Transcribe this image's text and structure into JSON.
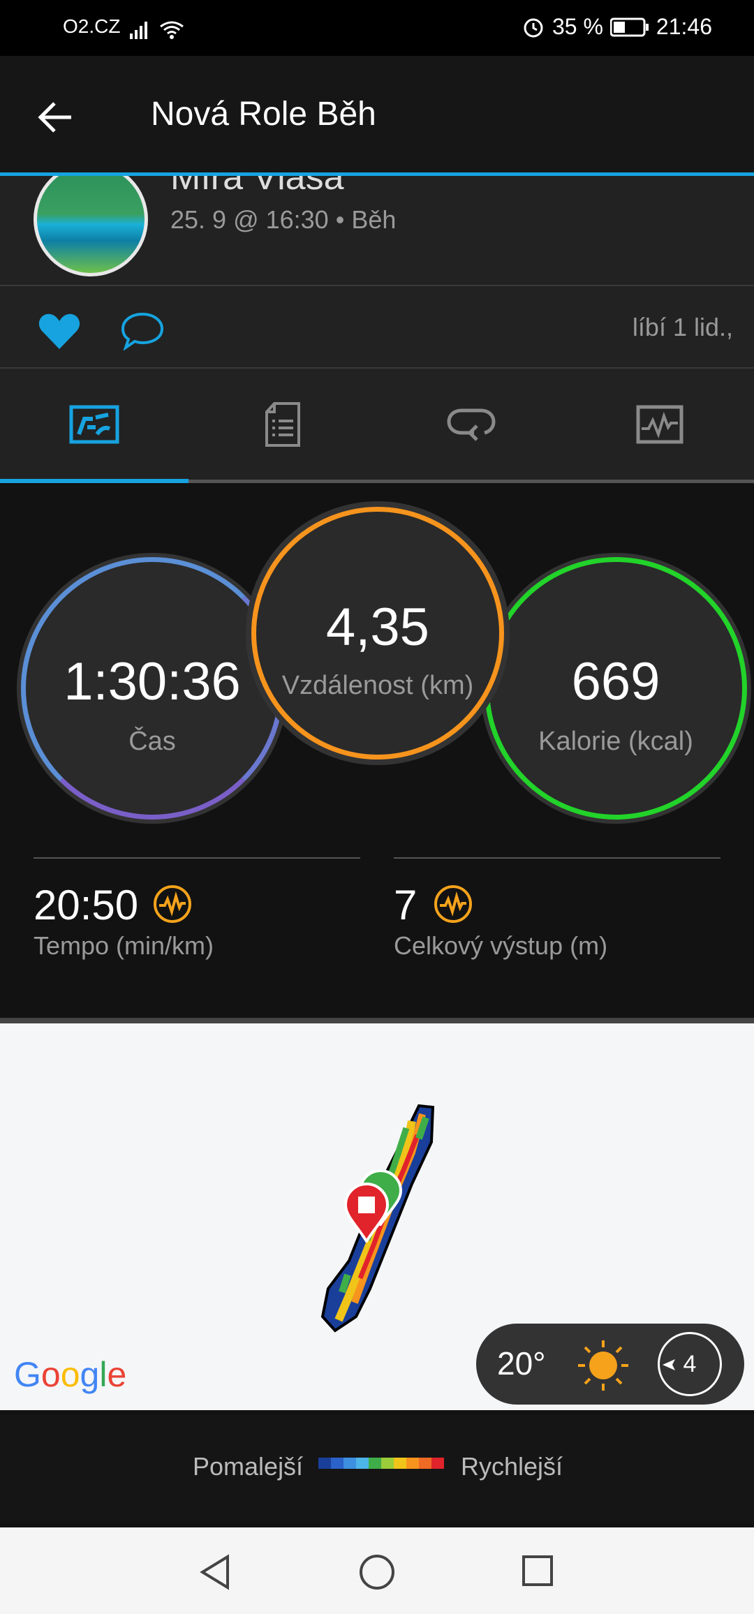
{
  "status_bar": {
    "carrier": "O2.CZ",
    "battery": "35 %",
    "time": "21:46"
  },
  "app_bar": {
    "title": "Nová Role Běh"
  },
  "profile": {
    "name": "Míra Vlasa",
    "meta": "25. 9 @ 16:30 • Běh"
  },
  "social": {
    "likes": "líbí 1 lid.,"
  },
  "tabs": [
    {
      "icon": "summary-icon",
      "active": true
    },
    {
      "icon": "details-icon",
      "active": false
    },
    {
      "icon": "laps-icon",
      "active": false
    },
    {
      "icon": "chart-icon",
      "active": false
    }
  ],
  "stats": {
    "time": {
      "value": "1:30:36",
      "label": "Čas"
    },
    "distance": {
      "value": "4,35",
      "label": "Vzdálenost (km)"
    },
    "calories": {
      "value": "669",
      "label": "Kalorie (kcal)"
    },
    "pace": {
      "value": "20:50",
      "label": "Tempo (min/km)"
    },
    "ascent": {
      "value": "7",
      "label": "Celkový výstup (m)"
    }
  },
  "colors": {
    "accent": "#16a3e0",
    "time_ring": "#5b8fd6",
    "distance_ring": "#f7941d",
    "calories_ring": "#22d32a",
    "metric_icon": "#f5a31c"
  },
  "map": {
    "provider": "Google",
    "weather": {
      "temperature": "20°",
      "wind": "4",
      "icon": "sun-icon"
    }
  },
  "legend": {
    "slow": "Pomalejší",
    "fast": "Rychlejší"
  }
}
